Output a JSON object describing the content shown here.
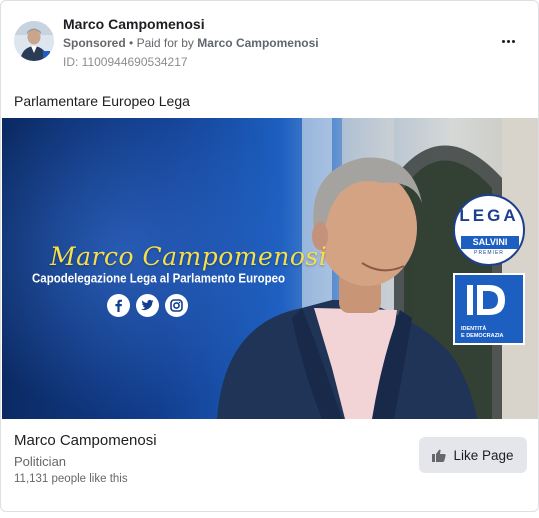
{
  "ad": {
    "advertiser_name": "Marco Campomenosi",
    "sponsored_label": "Sponsored",
    "separator": "•",
    "paid_for_prefix": "Paid for by",
    "payer_name": "Marco Campomenosi",
    "ad_id": "ID: 1100944690534217",
    "more_icon": "more-horizontal-icon",
    "body_text": "Parlamentare Europeo Lega"
  },
  "creative": {
    "name_script": "Marco Campomenosi",
    "subtitle": "Capodelegazione Lega al Parlamento Europeo",
    "social_icons": [
      "facebook-icon",
      "twitter-icon",
      "instagram-icon"
    ],
    "lega_logo": {
      "word": "LEGA",
      "banner": "SALVINI",
      "sub": "PREMIER"
    },
    "id_logo": {
      "caption_line1": "IDENTITÀ",
      "caption_line2": "E DEMOCRAZIA"
    }
  },
  "footer": {
    "page_name": "Marco Campomenosi",
    "category": "Politician",
    "likes": "11,131 people like this",
    "like_button_label": "Like Page",
    "like_icon": "thumbs-up-icon"
  },
  "colors": {
    "brand_blue": "#1d5fc0",
    "gold_text": "#f6df4a",
    "button_bg": "#e4e6eb"
  }
}
